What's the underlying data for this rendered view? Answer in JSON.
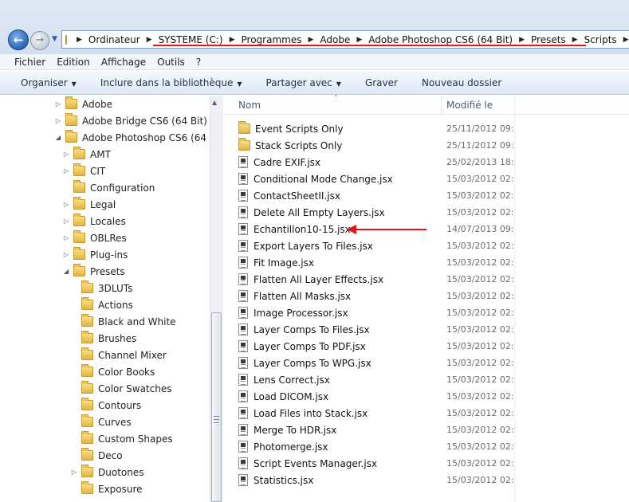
{
  "address": {
    "crumbs": [
      "Ordinateur",
      "SYSTEME (C:)",
      "Programmes",
      "Adobe",
      "Adobe Photoshop CS6 (64 Bit)",
      "Presets",
      "Scripts"
    ]
  },
  "menu": [
    "Fichier",
    "Edition",
    "Affichage",
    "Outils",
    "?"
  ],
  "toolbar": {
    "organize": "Organiser",
    "include": "Inclure dans la bibliothèque",
    "share": "Partager avec",
    "burn": "Graver",
    "new_folder": "Nouveau dossier"
  },
  "tree": [
    {
      "label": "Adobe",
      "expander": "▷"
    },
    {
      "label": "Adobe Bridge CS6 (64 Bit)",
      "expander": "▷"
    },
    {
      "label": "Adobe Photoshop CS6 (64 Bit)",
      "expander": "◢"
    },
    {
      "label": "AMT",
      "expander": "▷"
    },
    {
      "label": "CIT",
      "expander": "▷"
    },
    {
      "label": "Configuration",
      "expander": ""
    },
    {
      "label": "Legal",
      "expander": "▷"
    },
    {
      "label": "Locales",
      "expander": "▷"
    },
    {
      "label": "OBLRes",
      "expander": "▷"
    },
    {
      "label": "Plug-ins",
      "expander": "▷"
    },
    {
      "label": "Presets",
      "expander": "◢"
    },
    {
      "label": "3DLUTs",
      "expander": ""
    },
    {
      "label": "Actions",
      "expander": ""
    },
    {
      "label": "Black and White",
      "expander": ""
    },
    {
      "label": "Brushes",
      "expander": ""
    },
    {
      "label": "Channel Mixer",
      "expander": ""
    },
    {
      "label": "Color Books",
      "expander": ""
    },
    {
      "label": "Color Swatches",
      "expander": ""
    },
    {
      "label": "Contours",
      "expander": ""
    },
    {
      "label": "Curves",
      "expander": ""
    },
    {
      "label": "Custom Shapes",
      "expander": ""
    },
    {
      "label": "Deco",
      "expander": ""
    },
    {
      "label": "Duotones",
      "expander": "▷"
    },
    {
      "label": "Exposure",
      "expander": ""
    }
  ],
  "list": {
    "col_name": "Nom",
    "col_date": "Modifié le",
    "files": [
      {
        "name": "Event Scripts Only",
        "date": "25/11/2012 09:5",
        "type": "folder"
      },
      {
        "name": "Stack Scripts Only",
        "date": "25/11/2012 09:5",
        "type": "folder"
      },
      {
        "name": "Cadre EXIF.jsx",
        "date": "25/02/2013 18:0",
        "type": "jsx"
      },
      {
        "name": "Conditional Mode Change.jsx",
        "date": "15/03/2012 02:0",
        "type": "jsx"
      },
      {
        "name": "ContactSheetII.jsx",
        "date": "15/03/2012 02:0",
        "type": "jsx"
      },
      {
        "name": "Delete All Empty Layers.jsx",
        "date": "15/03/2012 02:0",
        "type": "jsx"
      },
      {
        "name": "Echantillon10-15.jsx",
        "date": "14/07/2013 09:1",
        "type": "jsx"
      },
      {
        "name": "Export Layers To Files.jsx",
        "date": "15/03/2012 02:0",
        "type": "jsx"
      },
      {
        "name": "Fit Image.jsx",
        "date": "15/03/2012 02:0",
        "type": "jsx"
      },
      {
        "name": "Flatten All Layer Effects.jsx",
        "date": "15/03/2012 02:0",
        "type": "jsx"
      },
      {
        "name": "Flatten All Masks.jsx",
        "date": "15/03/2012 02:0",
        "type": "jsx"
      },
      {
        "name": "Image Processor.jsx",
        "date": "15/03/2012 02:0",
        "type": "jsx"
      },
      {
        "name": "Layer Comps To Files.jsx",
        "date": "15/03/2012 02:0",
        "type": "jsx"
      },
      {
        "name": "Layer Comps To PDF.jsx",
        "date": "15/03/2012 02:0",
        "type": "jsx"
      },
      {
        "name": "Layer Comps To WPG.jsx",
        "date": "15/03/2012 02:0",
        "type": "jsx"
      },
      {
        "name": "Lens Correct.jsx",
        "date": "15/03/2012 02:0",
        "type": "jsx"
      },
      {
        "name": "Load DICOM.jsx",
        "date": "15/03/2012 02:0",
        "type": "jsx"
      },
      {
        "name": "Load Files into Stack.jsx",
        "date": "15/03/2012 02:0",
        "type": "jsx"
      },
      {
        "name": "Merge To HDR.jsx",
        "date": "15/03/2012 02:0",
        "type": "jsx"
      },
      {
        "name": "Photomerge.jsx",
        "date": "15/03/2012 02:0",
        "type": "jsx"
      },
      {
        "name": "Script Events Manager.jsx",
        "date": "15/03/2012 02:0",
        "type": "jsx"
      },
      {
        "name": "Statistics.jsx",
        "date": "15/03/2012 02:0",
        "type": "jsx"
      }
    ]
  },
  "annotation_color": "#e4131b"
}
